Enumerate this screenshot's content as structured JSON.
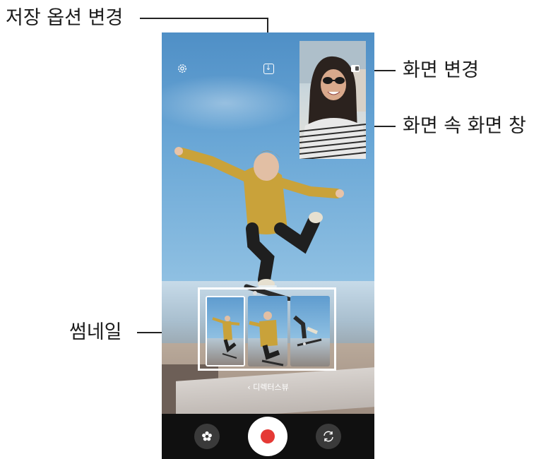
{
  "callouts": {
    "save_option": "저장 옵션 변경",
    "switch_screen": "화면 변경",
    "pip_window": "화면 속 화면 창",
    "thumbnails": "썸네일"
  },
  "camera": {
    "directors_view_link": "디렉터스뷰",
    "directors_view_chevron": "‹",
    "icons": {
      "settings": "gear-icon",
      "save_option": "download-icon",
      "switch_screen": "switch-screen-icon",
      "effects": "effects-icon",
      "shutter": "record-icon",
      "flip": "flip-camera-icon"
    },
    "record_color": "#e53935"
  }
}
